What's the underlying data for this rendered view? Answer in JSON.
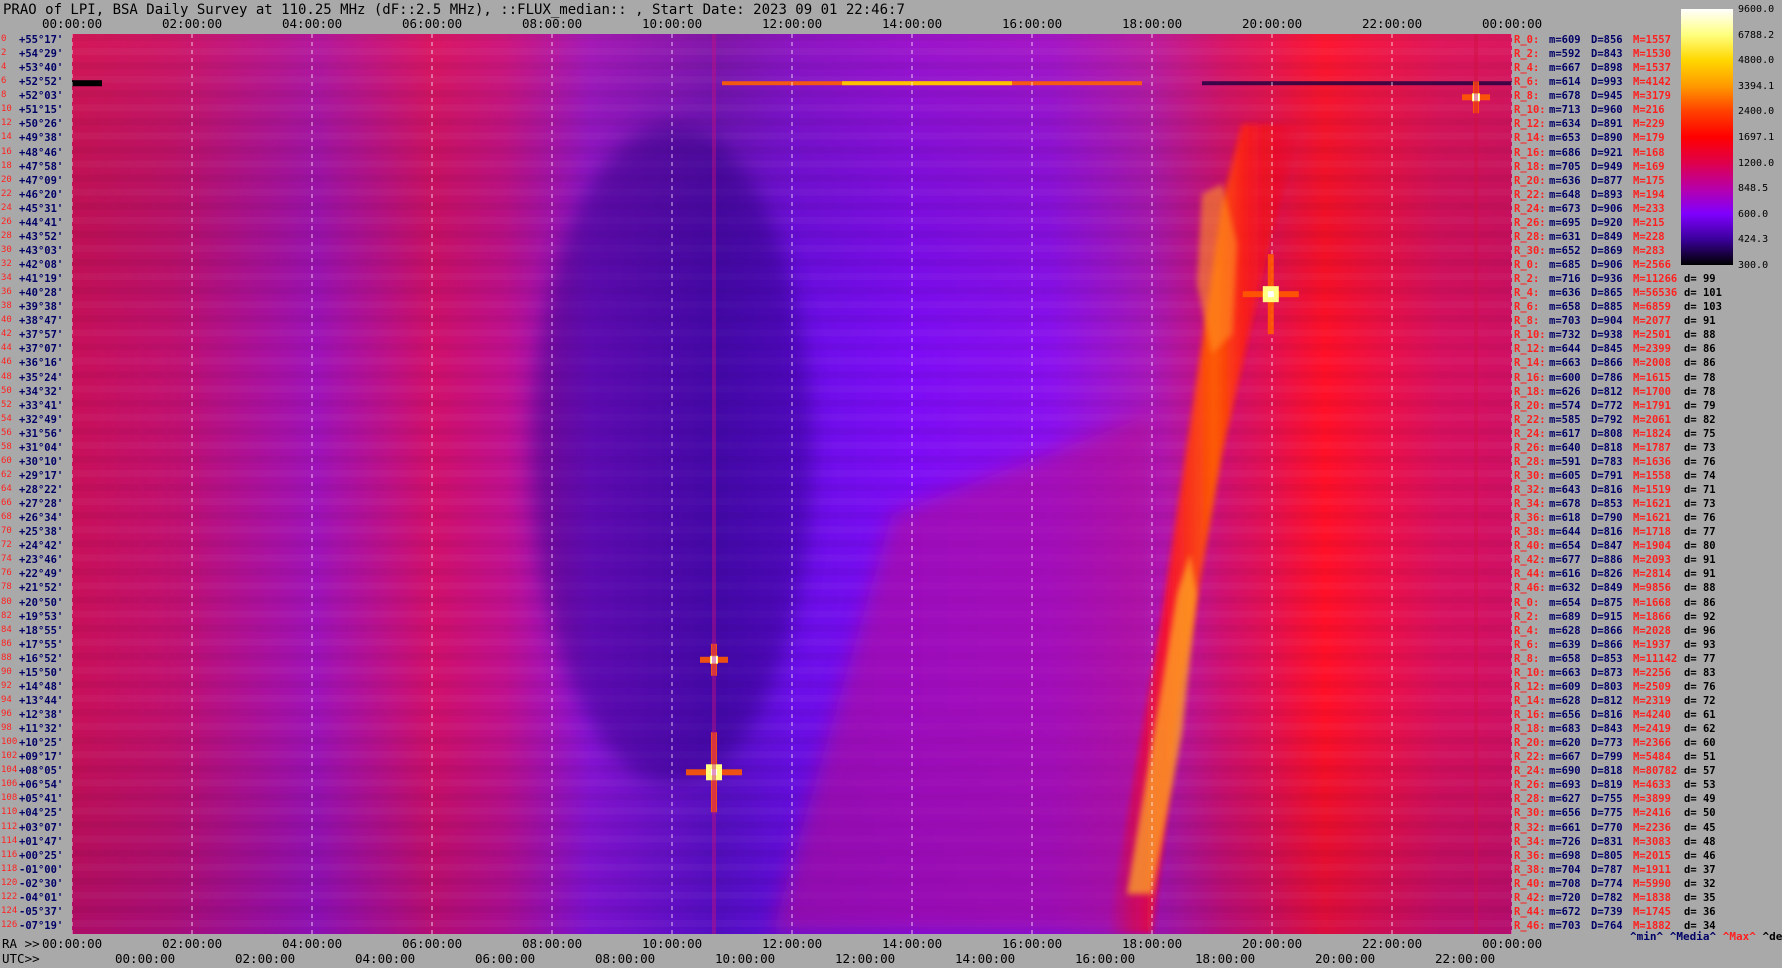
{
  "title": "PRAO of LPI, BSA Daily Survey at 110.25 MHz (dF::2.5 MHz), ::FLUX_median:: , Start Date: 2023 09 01 22:46:7",
  "top_axis_labels": [
    "00:00:00",
    "02:00:00",
    "04:00:00",
    "06:00:00",
    "08:00:00",
    "10:00:00",
    "12:00:00",
    "14:00:00",
    "16:00:00",
    "18:00:00",
    "20:00:00",
    "22:00:00",
    "00:00:00"
  ],
  "bottom_axis": {
    "ra_prefix": "RA >>",
    "utc_prefix": "UTC>>",
    "ra_labels": [
      "00:00:00",
      "02:00:00",
      "04:00:00",
      "06:00:00",
      "08:00:00",
      "10:00:00",
      "12:00:00",
      "14:00:00",
      "16:00:00",
      "18:00:00",
      "20:00:00",
      "22:00:00",
      "00:00:00"
    ],
    "utc_labels": [
      "00:00:00",
      "02:00:00",
      "04:00:00",
      "06:00:00",
      "08:00:00",
      "10:00:00",
      "12:00:00",
      "14:00:00",
      "16:00:00",
      "18:00:00",
      "20:00:00",
      "22:00:00"
    ]
  },
  "colorbar": {
    "labels": [
      "9600.0",
      "6788.2",
      "4800.0",
      "3394.1",
      "2400.0",
      "1697.1",
      "1200.0",
      "848.5",
      "600.0",
      "424.3",
      "300.0"
    ],
    "stops": [
      "#ffffff",
      "#ffff80",
      "#ffd700",
      "#ff9a00",
      "#ff4000",
      "#ff0000",
      "#e0004a",
      "#b800a8",
      "#7f00ff",
      "#3a009a",
      "#000000"
    ]
  },
  "legend": {
    "min": "^min^",
    "median": "^Media^",
    "max": "^Max^",
    "devia": "^devia^"
  },
  "colors": {
    "background": "#a9a9a9",
    "axis_text": "#000000",
    "row_red": "#ff2020",
    "row_blue": "#000066",
    "grid": "#ffffff"
  },
  "rows": [
    {
      "idx": "0",
      "dec": "+55°17'",
      "r": "R_0:",
      "m": "m=609",
      "d": "D=856",
      "M": "M=1557",
      "dev": ""
    },
    {
      "idx": "2",
      "dec": "+54°29'",
      "r": "R_2:",
      "m": "m=592",
      "d": "D=843",
      "M": "M=1530",
      "dev": ""
    },
    {
      "idx": "4",
      "dec": "+53°40'",
      "r": "R_4:",
      "m": "m=667",
      "d": "D=898",
      "M": "M=1537",
      "dev": ""
    },
    {
      "idx": "6",
      "dec": "+52°52'",
      "r": "R_6:",
      "m": "m=614",
      "d": "D=993",
      "M": "M=4142",
      "dev": ""
    },
    {
      "idx": "8",
      "dec": "+52°03'",
      "r": "R_8:",
      "m": "m=678",
      "d": "D=945",
      "M": "M=3179",
      "dev": ""
    },
    {
      "idx": "10",
      "dec": "+51°15'",
      "r": "R_10:",
      "m": "m=713",
      "d": "D=960",
      "M": "M=216",
      "dev": ""
    },
    {
      "idx": "12",
      "dec": "+50°26'",
      "r": "R_12:",
      "m": "m=634",
      "d": "D=891",
      "M": "M=229",
      "dev": ""
    },
    {
      "idx": "14",
      "dec": "+49°38'",
      "r": "R_14:",
      "m": "m=653",
      "d": "D=890",
      "M": "M=179",
      "dev": ""
    },
    {
      "idx": "16",
      "dec": "+48°46'",
      "r": "R_16:",
      "m": "m=686",
      "d": "D=921",
      "M": "M=168",
      "dev": ""
    },
    {
      "idx": "18",
      "dec": "+47°58'",
      "r": "R_18:",
      "m": "m=705",
      "d": "D=949",
      "M": "M=169",
      "dev": ""
    },
    {
      "idx": "20",
      "dec": "+47°09'",
      "r": "R_20:",
      "m": "m=636",
      "d": "D=877",
      "M": "M=175",
      "dev": ""
    },
    {
      "idx": "22",
      "dec": "+46°20'",
      "r": "R_22:",
      "m": "m=648",
      "d": "D=893",
      "M": "M=194",
      "dev": ""
    },
    {
      "idx": "24",
      "dec": "+45°31'",
      "r": "R_24:",
      "m": "m=673",
      "d": "D=906",
      "M": "M=233",
      "dev": ""
    },
    {
      "idx": "26",
      "dec": "+44°41'",
      "r": "R_26:",
      "m": "m=695",
      "d": "D=920",
      "M": "M=215",
      "dev": ""
    },
    {
      "idx": "28",
      "dec": "+43°52'",
      "r": "R_28:",
      "m": "m=631",
      "d": "D=849",
      "M": "M=228",
      "dev": ""
    },
    {
      "idx": "30",
      "dec": "+43°03'",
      "r": "R_30:",
      "m": "m=652",
      "d": "D=869",
      "M": "M=283",
      "dev": ""
    },
    {
      "idx": "32",
      "dec": "+42°08'",
      "r": "R_0:",
      "m": "m=685",
      "d": "D=906",
      "M": "M=2566",
      "dev": ""
    },
    {
      "idx": "34",
      "dec": "+41°19'",
      "r": "R_2:",
      "m": "m=716",
      "d": "D=936",
      "M": "M=11266",
      "dev": "d= 99"
    },
    {
      "idx": "36",
      "dec": "+40°28'",
      "r": "R_4:",
      "m": "m=636",
      "d": "D=865",
      "M": "M=56536",
      "dev": "d= 101"
    },
    {
      "idx": "38",
      "dec": "+39°38'",
      "r": "R_6:",
      "m": "m=658",
      "d": "D=885",
      "M": "M=6859",
      "dev": "d= 103"
    },
    {
      "idx": "40",
      "dec": "+38°47'",
      "r": "R_8:",
      "m": "m=703",
      "d": "D=904",
      "M": "M=2077",
      "dev": "d= 91"
    },
    {
      "idx": "42",
      "dec": "+37°57'",
      "r": "R_10:",
      "m": "m=732",
      "d": "D=938",
      "M": "M=2501",
      "dev": "d= 88"
    },
    {
      "idx": "44",
      "dec": "+37°07'",
      "r": "R_12:",
      "m": "m=644",
      "d": "D=845",
      "M": "M=2399",
      "dev": "d= 86"
    },
    {
      "idx": "46",
      "dec": "+36°16'",
      "r": "R_14:",
      "m": "m=663",
      "d": "D=866",
      "M": "M=2008",
      "dev": "d= 86"
    },
    {
      "idx": "48",
      "dec": "+35°24'",
      "r": "R_16:",
      "m": "m=600",
      "d": "D=786",
      "M": "M=1615",
      "dev": "d= 78"
    },
    {
      "idx": "50",
      "dec": "+34°32'",
      "r": "R_18:",
      "m": "m=626",
      "d": "D=812",
      "M": "M=1700",
      "dev": "d= 78"
    },
    {
      "idx": "52",
      "dec": "+33°41'",
      "r": "R_20:",
      "m": "m=574",
      "d": "D=772",
      "M": "M=1791",
      "dev": "d= 79"
    },
    {
      "idx": "54",
      "dec": "+32°49'",
      "r": "R_22:",
      "m": "m=585",
      "d": "D=792",
      "M": "M=2061",
      "dev": "d= 82"
    },
    {
      "idx": "56",
      "dec": "+31°56'",
      "r": "R_24:",
      "m": "m=617",
      "d": "D=808",
      "M": "M=1824",
      "dev": "d= 75"
    },
    {
      "idx": "58",
      "dec": "+31°04'",
      "r": "R_26:",
      "m": "m=640",
      "d": "D=818",
      "M": "M=1787",
      "dev": "d= 73"
    },
    {
      "idx": "60",
      "dec": "+30°10'",
      "r": "R_28:",
      "m": "m=591",
      "d": "D=783",
      "M": "M=1636",
      "dev": "d= 76"
    },
    {
      "idx": "62",
      "dec": "+29°17'",
      "r": "R_30:",
      "m": "m=605",
      "d": "D=791",
      "M": "M=1558",
      "dev": "d= 74"
    },
    {
      "idx": "64",
      "dec": "+28°22'",
      "r": "R_32:",
      "m": "m=643",
      "d": "D=816",
      "M": "M=1519",
      "dev": "d= 71"
    },
    {
      "idx": "66",
      "dec": "+27°28'",
      "r": "R_34:",
      "m": "m=678",
      "d": "D=853",
      "M": "M=1621",
      "dev": "d= 73"
    },
    {
      "idx": "68",
      "dec": "+26°34'",
      "r": "R_36:",
      "m": "m=618",
      "d": "D=790",
      "M": "M=1621",
      "dev": "d= 76"
    },
    {
      "idx": "70",
      "dec": "+25°38'",
      "r": "R_38:",
      "m": "m=644",
      "d": "D=816",
      "M": "M=1718",
      "dev": "d= 77"
    },
    {
      "idx": "72",
      "dec": "+24°42'",
      "r": "R_40:",
      "m": "m=654",
      "d": "D=847",
      "M": "M=1904",
      "dev": "d= 80"
    },
    {
      "idx": "74",
      "dec": "+23°46'",
      "r": "R_42:",
      "m": "m=677",
      "d": "D=886",
      "M": "M=2093",
      "dev": "d= 91"
    },
    {
      "idx": "76",
      "dec": "+22°49'",
      "r": "R_44:",
      "m": "m=616",
      "d": "D=826",
      "M": "M=2814",
      "dev": "d= 91"
    },
    {
      "idx": "78",
      "dec": "+21°52'",
      "r": "R_46:",
      "m": "m=632",
      "d": "D=849",
      "M": "M=9856",
      "dev": "d= 88"
    },
    {
      "idx": "80",
      "dec": "+20°50'",
      "r": "R_0:",
      "m": "m=654",
      "d": "D=875",
      "M": "M=1668",
      "dev": "d= 86"
    },
    {
      "idx": "82",
      "dec": "+19°53'",
      "r": "R_2:",
      "m": "m=689",
      "d": "D=915",
      "M": "M=1866",
      "dev": "d= 92"
    },
    {
      "idx": "84",
      "dec": "+18°55'",
      "r": "R_4:",
      "m": "m=628",
      "d": "D=866",
      "M": "M=2028",
      "dev": "d= 96"
    },
    {
      "idx": "86",
      "dec": "+17°55'",
      "r": "R_6:",
      "m": "m=639",
      "d": "D=866",
      "M": "M=1937",
      "dev": "d= 93"
    },
    {
      "idx": "88",
      "dec": "+16°52'",
      "r": "R_8:",
      "m": "m=658",
      "d": "D=853",
      "M": "M=11142",
      "dev": "d= 77"
    },
    {
      "idx": "90",
      "dec": "+15°50'",
      "r": "R_10:",
      "m": "m=663",
      "d": "D=873",
      "M": "M=2256",
      "dev": "d= 83"
    },
    {
      "idx": "92",
      "dec": "+14°48'",
      "r": "R_12:",
      "m": "m=609",
      "d": "D=803",
      "M": "M=2509",
      "dev": "d= 76"
    },
    {
      "idx": "94",
      "dec": "+13°44'",
      "r": "R_14:",
      "m": "m=628",
      "d": "D=812",
      "M": "M=2319",
      "dev": "d= 72"
    },
    {
      "idx": "96",
      "dec": "+12°38'",
      "r": "R_16:",
      "m": "m=656",
      "d": "D=816",
      "M": "M=4240",
      "dev": "d= 61"
    },
    {
      "idx": "98",
      "dec": "+11°32'",
      "r": "R_18:",
      "m": "m=683",
      "d": "D=843",
      "M": "M=2419",
      "dev": "d= 62"
    },
    {
      "idx": "100",
      "dec": "+10°25'",
      "r": "R_20:",
      "m": "m=620",
      "d": "D=773",
      "M": "M=2366",
      "dev": "d= 60"
    },
    {
      "idx": "102",
      "dec": "+09°17'",
      "r": "R_22:",
      "m": "m=667",
      "d": "D=799",
      "M": "M=5484",
      "dev": "d= 51"
    },
    {
      "idx": "104",
      "dec": "+08°05'",
      "r": "R_24:",
      "m": "m=690",
      "d": "D=818",
      "M": "M=80782",
      "dev": "d= 57"
    },
    {
      "idx": "106",
      "dec": "+06°54'",
      "r": "R_26:",
      "m": "m=693",
      "d": "D=819",
      "M": "M=4633",
      "dev": "d= 53"
    },
    {
      "idx": "108",
      "dec": "+05°41'",
      "r": "R_28:",
      "m": "m=627",
      "d": "D=755",
      "M": "M=3899",
      "dev": "d= 49"
    },
    {
      "idx": "110",
      "dec": "+04°25'",
      "r": "R_30:",
      "m": "m=656",
      "d": "D=775",
      "M": "M=2416",
      "dev": "d= 50"
    },
    {
      "idx": "112",
      "dec": "+03°07'",
      "r": "R_32:",
      "m": "m=661",
      "d": "D=770",
      "M": "M=2236",
      "dev": "d= 45"
    },
    {
      "idx": "114",
      "dec": "+01°47'",
      "r": "R_34:",
      "m": "m=726",
      "d": "D=831",
      "M": "M=3083",
      "dev": "d= 48"
    },
    {
      "idx": "116",
      "dec": "+00°25'",
      "r": "R_36:",
      "m": "m=698",
      "d": "D=805",
      "M": "M=2015",
      "dev": "d= 46"
    },
    {
      "idx": "118",
      "dec": "-01°00'",
      "r": "R_38:",
      "m": "m=704",
      "d": "D=787",
      "M": "M=1911",
      "dev": "d= 37"
    },
    {
      "idx": "120",
      "dec": "-02°30'",
      "r": "R_40:",
      "m": "m=708",
      "d": "D=774",
      "M": "M=5990",
      "dev": "d= 32"
    },
    {
      "idx": "122",
      "dec": "-04°01'",
      "r": "R_42:",
      "m": "m=720",
      "d": "D=782",
      "M": "M=1838",
      "dev": "d= 35"
    },
    {
      "idx": "124",
      "dec": "-05°37'",
      "r": "R_44:",
      "m": "m=672",
      "d": "D=739",
      "M": "M=1745",
      "dev": "d= 36"
    },
    {
      "idx": "126",
      "dec": "-07°19'",
      "r": "R_46:",
      "m": "m=703",
      "d": "D=764",
      "M": "M=1882",
      "dev": "d= 34"
    }
  ],
  "chart_data": {
    "type": "heatmap",
    "title": "PRAO of LPI, BSA Daily Survey at 110.25 MHz (dF::2.5 MHz), ::FLUX_median:: , Start Date: 2023 09 01 22:46:7",
    "xlabel": "RA / UTC",
    "ylabel": "",
    "x_range_hours": [
      0,
      24
    ],
    "scale": "log",
    "value_range": [
      300.0,
      9600.0
    ],
    "row_count": 64,
    "sources": [
      {
        "name": "",
        "ra_hours": 19.98,
        "dec": "+40°28'",
        "peak_flux": 56536
      },
      {
        "name": "",
        "ra_hours": 10.7,
        "dec": "+08°05'",
        "peak_flux": 80782
      },
      {
        "name": "",
        "ra_hours": 10.7,
        "dec": "+16°52'",
        "peak_flux": 11142
      },
      {
        "name": "",
        "ra_hours": 23.4,
        "dec": "+52°03'",
        "peak_flux": 3179
      }
    ],
    "background_features": {
      "galactic_plane_band_ra_hours": [
        19,
        21
      ],
      "vertical_dashed_grid_hours": [
        0,
        2,
        4,
        6,
        8,
        10,
        12,
        14,
        16,
        18,
        20,
        22,
        24
      ]
    }
  }
}
